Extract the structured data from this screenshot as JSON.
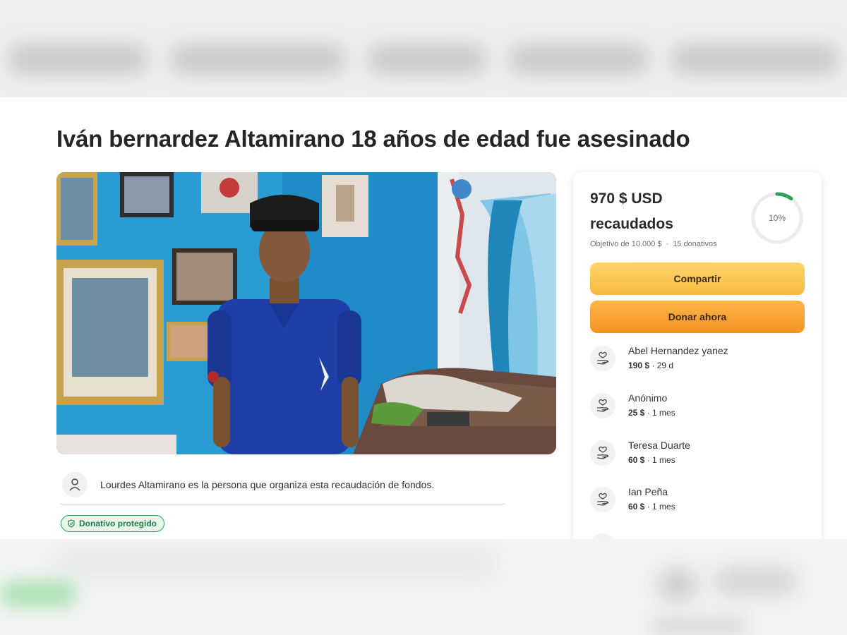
{
  "campaign": {
    "title": "Iván bernardez Altamirano 18 años de edad fue asesinado",
    "organizer_text": "Lourdes Altamirano es la persona que organiza esta recaudación de fondos.",
    "protected_badge": "Donativo protegido"
  },
  "summary": {
    "amount": "970 $ USD",
    "raised_label": "recaudados",
    "goal": "Objetivo de 10.000 $",
    "separator": "·",
    "donations_count": "15 donativos",
    "progress_label": "10%",
    "progress_fraction": 0.1
  },
  "buttons": {
    "share": "Compartir",
    "donate": "Donar ahora"
  },
  "donors": [
    {
      "name": "Abel Hernandez yanez",
      "amount": "190 $",
      "time": "· 29 d"
    },
    {
      "name": "Anónimo",
      "amount": "25 $",
      "time": "· 1 mes"
    },
    {
      "name": "Teresa Duarte",
      "amount": "60 $",
      "time": "· 1 mes"
    },
    {
      "name": "Ian Peña",
      "amount": "60 $",
      "time": "· 1 mes"
    }
  ],
  "icons": {
    "organizer": "person-icon",
    "badge": "shield-icon",
    "donor": "donation-hand-icon"
  },
  "colors": {
    "progress": "#29a15a",
    "share_button": "#f6b93e",
    "donate_button": "#f39223",
    "badge_green": "#29a15a"
  }
}
